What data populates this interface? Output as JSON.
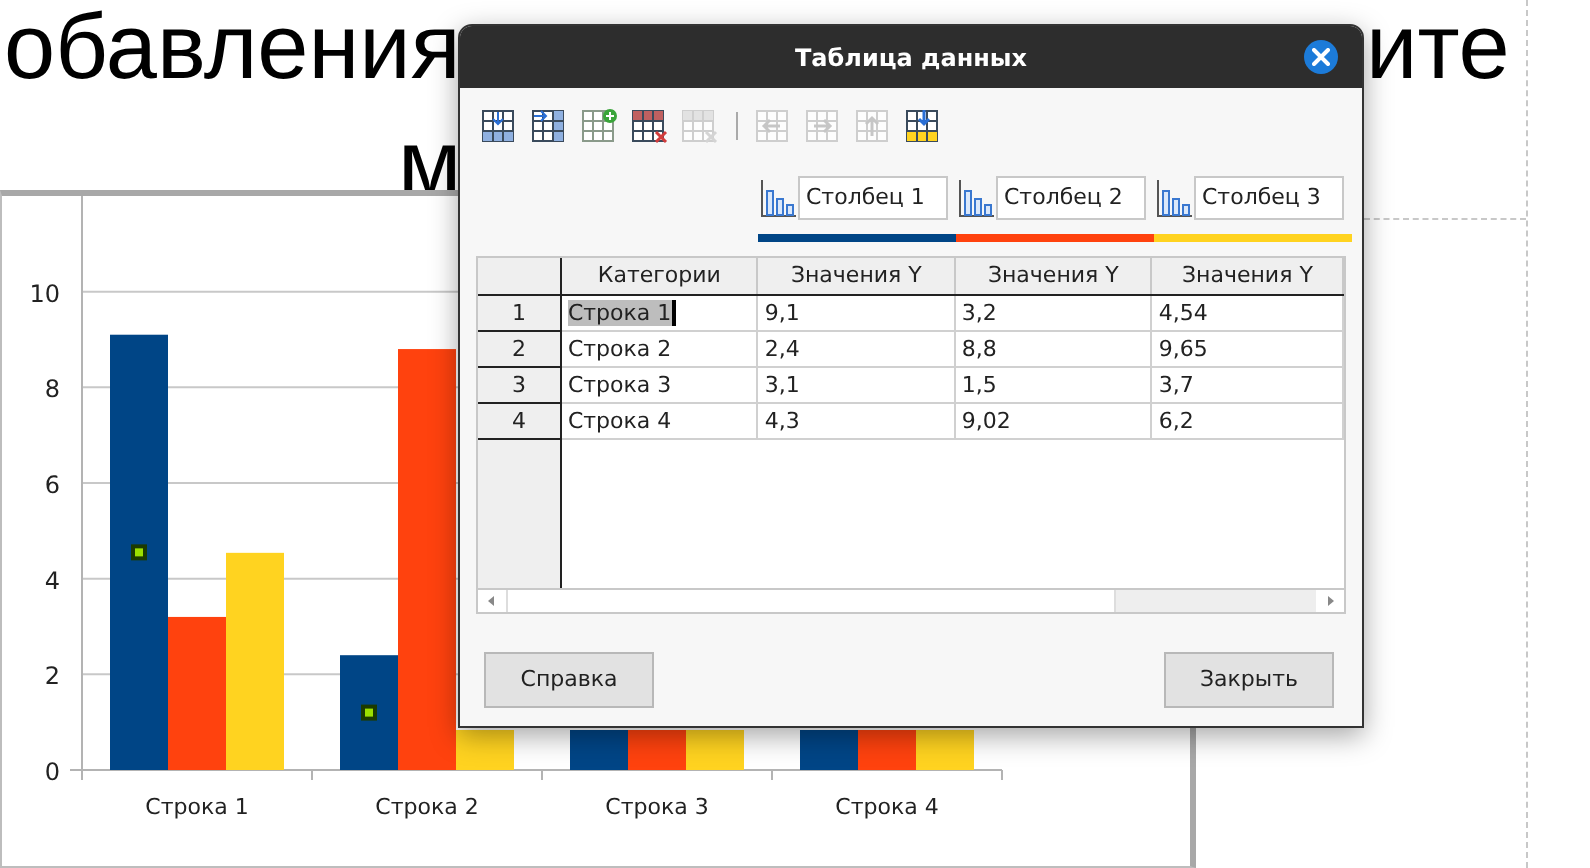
{
  "slide": {
    "title_lines": [
      "обавления",
      "ите",
      "м"
    ]
  },
  "chart": {
    "chart_data": {
      "type": "bar",
      "categories": [
        "Строка 1",
        "Строка 2",
        "Строка 3",
        "Строка 4"
      ],
      "ylim": [
        0,
        12
      ],
      "yticks": [
        0,
        2,
        4,
        6,
        8,
        10
      ],
      "grid": true,
      "series": [
        {
          "color": "#004586",
          "values": [
            9.1,
            2.4,
            null,
            null
          ]
        },
        {
          "color": "#ff420e",
          "values": [
            3.2,
            8.8,
            null,
            null
          ]
        },
        {
          "color": "#ffd320",
          "values": [
            4.54,
            null,
            null,
            null
          ]
        }
      ]
    }
  },
  "dialog": {
    "title": "Таблица данных",
    "toolbar": [
      {
        "kind": "insert-row",
        "disabled": false
      },
      {
        "kind": "insert-series",
        "disabled": false
      },
      {
        "kind": "insert-text",
        "disabled": false
      },
      {
        "kind": "delete-row",
        "disabled": false
      },
      {
        "kind": "delete-series",
        "disabled": true
      },
      {
        "kind": "separator"
      },
      {
        "kind": "move-left",
        "disabled": true
      },
      {
        "kind": "move-right",
        "disabled": true
      },
      {
        "kind": "move-up",
        "disabled": true
      },
      {
        "kind": "move-down",
        "disabled": false
      }
    ],
    "series": [
      {
        "name": "Столбец 1",
        "color": "#004586"
      },
      {
        "name": "Столбец 2",
        "color": "#ff420e"
      },
      {
        "name": "Столбец 3",
        "color": "#ffd320"
      }
    ],
    "table": {
      "columns": [
        "Категории",
        "Значения Y",
        "Значения Y",
        "Значения Y"
      ],
      "rows": [
        {
          "number": "1",
          "cells": [
            {
              "text": "Строка 1",
              "selected": true
            },
            {
              "text": "9,1",
              "selected": false
            },
            {
              "text": "3,2",
              "selected": false
            },
            {
              "text": "4,54",
              "selected": false
            }
          ]
        },
        {
          "number": "2",
          "cells": [
            {
              "text": "Строка 2",
              "selected": false
            },
            {
              "text": "2,4",
              "selected": false
            },
            {
              "text": "8,8",
              "selected": false
            },
            {
              "text": "9,65",
              "selected": false
            }
          ]
        },
        {
          "number": "3",
          "cells": [
            {
              "text": "Строка 3",
              "selected": false
            },
            {
              "text": "3,1",
              "selected": false
            },
            {
              "text": "1,5",
              "selected": false
            },
            {
              "text": "3,7",
              "selected": false
            }
          ]
        },
        {
          "number": "4",
          "cells": [
            {
              "text": "Строка 4",
              "selected": false
            },
            {
              "text": "4,3",
              "selected": false
            },
            {
              "text": "9,02",
              "selected": false
            },
            {
              "text": "6,2",
              "selected": false
            }
          ]
        }
      ]
    },
    "buttons": [
      "Справка",
      "Закрыть"
    ]
  }
}
